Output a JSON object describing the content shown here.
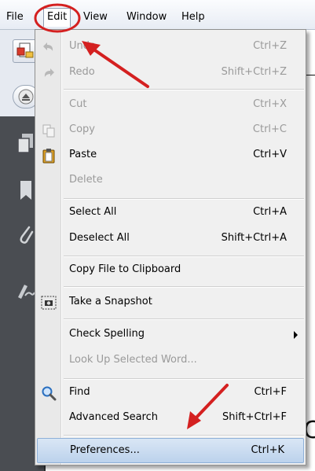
{
  "menubar": {
    "file": "File",
    "edit": "Edit",
    "view": "View",
    "window": "Window",
    "help": "Help"
  },
  "menu": {
    "undo": {
      "label": "Undo",
      "shortcut": "Ctrl+Z",
      "enabled": false
    },
    "redo": {
      "label": "Redo",
      "shortcut": "Shift+Ctrl+Z",
      "enabled": false
    },
    "cut": {
      "label": "Cut",
      "shortcut": "Ctrl+X",
      "enabled": false
    },
    "copy": {
      "label": "Copy",
      "shortcut": "Ctrl+C",
      "enabled": false
    },
    "paste": {
      "label": "Paste",
      "shortcut": "Ctrl+V",
      "enabled": true
    },
    "delete": {
      "label": "Delete",
      "shortcut": "",
      "enabled": false
    },
    "select_all": {
      "label": "Select All",
      "shortcut": "Ctrl+A",
      "enabled": true
    },
    "deselect_all": {
      "label": "Deselect All",
      "shortcut": "Shift+Ctrl+A",
      "enabled": true
    },
    "copy_file": {
      "label": "Copy File to Clipboard",
      "shortcut": "",
      "enabled": true
    },
    "snapshot": {
      "label": "Take a Snapshot",
      "shortcut": "",
      "enabled": true
    },
    "check_spelling": {
      "label": "Check Spelling",
      "shortcut": "",
      "enabled": true
    },
    "look_up": {
      "label": "Look Up Selected Word...",
      "shortcut": "",
      "enabled": false
    },
    "find": {
      "label": "Find",
      "shortcut": "Ctrl+F",
      "enabled": true
    },
    "advanced_search": {
      "label": "Advanced Search",
      "shortcut": "Shift+Ctrl+F",
      "enabled": true
    },
    "preferences": {
      "label": "Preferences...",
      "shortcut": "Ctrl+K",
      "enabled": true,
      "highlighted": true
    }
  },
  "document": {
    "visible_char": "C"
  },
  "colors": {
    "annotation_red": "#d42020",
    "highlight": "#c6d9f0",
    "nav_pane": "#4a4d52"
  }
}
